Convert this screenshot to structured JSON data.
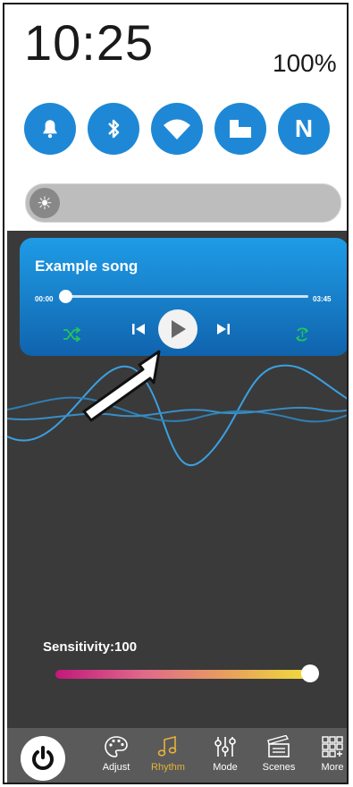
{
  "status": {
    "time": "10:25",
    "battery": "100%"
  },
  "quick_settings": [
    {
      "icon": "bell-icon"
    },
    {
      "icon": "bluetooth-icon"
    },
    {
      "icon": "wifi-icon"
    },
    {
      "icon": "rotate-icon"
    },
    {
      "icon": "nfc-icon",
      "glyph": "N"
    }
  ],
  "brightness": {
    "icon": "sun-icon",
    "glyph": "☀"
  },
  "player": {
    "song": "Example song",
    "elapsed": "00:00",
    "duration": "03:45",
    "progress": 0.0
  },
  "sensitivity": {
    "label": "Sensitivity:100",
    "value": 100
  },
  "nav": {
    "tabs": [
      {
        "label": "Adjust",
        "icon": "palette-icon"
      },
      {
        "label": "Rhythm",
        "icon": "music-note-icon",
        "active": true
      },
      {
        "label": "Mode",
        "icon": "sliders-icon"
      },
      {
        "label": "Scenes",
        "icon": "clapperboard-icon"
      },
      {
        "label": "More",
        "icon": "grid-icon"
      }
    ]
  },
  "colors": {
    "accent": "#1e88d6",
    "active_tab": "#e6b23a",
    "wave": "#3aa0e0",
    "shuffle": "#22c55e"
  }
}
